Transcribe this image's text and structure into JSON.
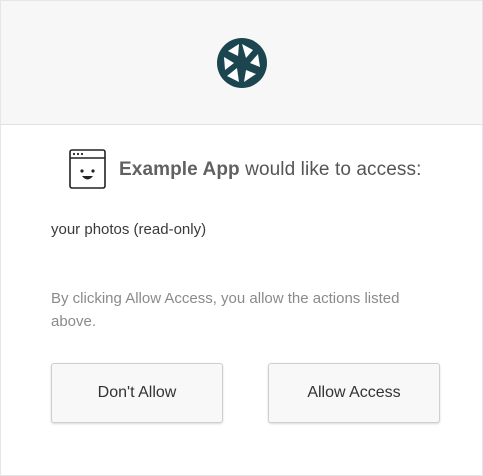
{
  "header": {
    "logo_icon": "camera-aperture-icon",
    "logo_color": "#1b4650"
  },
  "request": {
    "app_icon": "browser-window-smiley-icon",
    "app_name": "Example App",
    "message": "would like to access:"
  },
  "scope": {
    "text": "your photos (read-only)"
  },
  "notice": {
    "text": "By clicking Allow Access, you allow the actions listed above."
  },
  "actions": {
    "deny_label": "Don't Allow",
    "allow_label": "Allow Access"
  }
}
